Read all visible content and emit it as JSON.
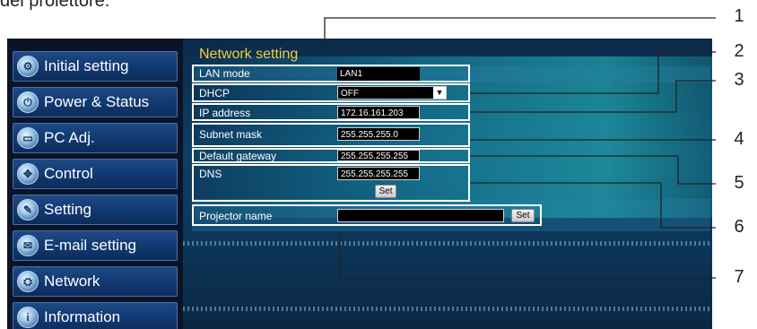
{
  "intro_text": "del proiettore.",
  "panel_title": "Network setting",
  "sidebar": {
    "items": [
      {
        "label": "Initial setting"
      },
      {
        "label": "Power & Status"
      },
      {
        "label": "PC Adj."
      },
      {
        "label": "Control"
      },
      {
        "label": "Setting"
      },
      {
        "label": "E-mail setting"
      },
      {
        "label": "Network"
      },
      {
        "label": "Information"
      }
    ]
  },
  "settings": {
    "lan_mode": {
      "label": "LAN mode",
      "value": "LAN1"
    },
    "dhcp": {
      "label": "DHCP",
      "value": "OFF"
    },
    "ip_address": {
      "label": "IP address",
      "value": "172.16.161.203"
    },
    "subnet_mask": {
      "label": "Subnet mask",
      "value": "255.255.255.0"
    },
    "default_gateway": {
      "label": "Default gateway",
      "value": "255.255.255.255"
    },
    "dns": {
      "label": "DNS",
      "value": "255.255.255.255",
      "set_label": "Set"
    },
    "projector_name": {
      "label": "Projector name",
      "value": "",
      "set_label": "Set"
    }
  },
  "callouts": [
    "1",
    "2",
    "3",
    "4",
    "5",
    "6",
    "7"
  ]
}
